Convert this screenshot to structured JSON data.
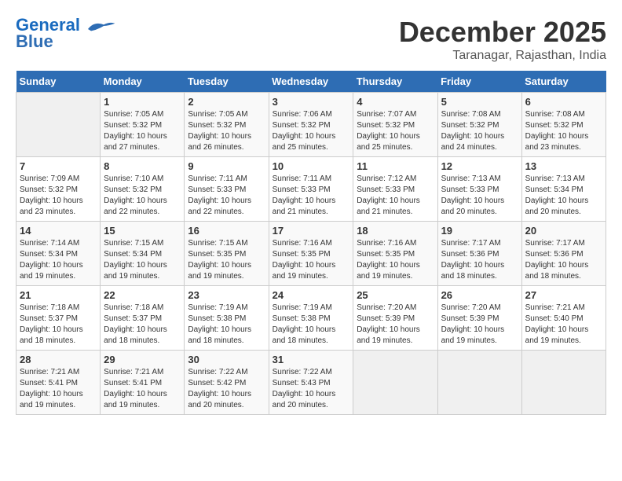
{
  "logo": {
    "line1": "General",
    "line2": "Blue"
  },
  "title": {
    "month": "December 2025",
    "location": "Taranagar, Rajasthan, India"
  },
  "weekdays": [
    "Sunday",
    "Monday",
    "Tuesday",
    "Wednesday",
    "Thursday",
    "Friday",
    "Saturday"
  ],
  "weeks": [
    [
      {
        "day": "",
        "info": ""
      },
      {
        "day": "1",
        "info": "Sunrise: 7:05 AM\nSunset: 5:32 PM\nDaylight: 10 hours\nand 27 minutes."
      },
      {
        "day": "2",
        "info": "Sunrise: 7:05 AM\nSunset: 5:32 PM\nDaylight: 10 hours\nand 26 minutes."
      },
      {
        "day": "3",
        "info": "Sunrise: 7:06 AM\nSunset: 5:32 PM\nDaylight: 10 hours\nand 25 minutes."
      },
      {
        "day": "4",
        "info": "Sunrise: 7:07 AM\nSunset: 5:32 PM\nDaylight: 10 hours\nand 25 minutes."
      },
      {
        "day": "5",
        "info": "Sunrise: 7:08 AM\nSunset: 5:32 PM\nDaylight: 10 hours\nand 24 minutes."
      },
      {
        "day": "6",
        "info": "Sunrise: 7:08 AM\nSunset: 5:32 PM\nDaylight: 10 hours\nand 23 minutes."
      }
    ],
    [
      {
        "day": "7",
        "info": "Sunrise: 7:09 AM\nSunset: 5:32 PM\nDaylight: 10 hours\nand 23 minutes."
      },
      {
        "day": "8",
        "info": "Sunrise: 7:10 AM\nSunset: 5:32 PM\nDaylight: 10 hours\nand 22 minutes."
      },
      {
        "day": "9",
        "info": "Sunrise: 7:11 AM\nSunset: 5:33 PM\nDaylight: 10 hours\nand 22 minutes."
      },
      {
        "day": "10",
        "info": "Sunrise: 7:11 AM\nSunset: 5:33 PM\nDaylight: 10 hours\nand 21 minutes."
      },
      {
        "day": "11",
        "info": "Sunrise: 7:12 AM\nSunset: 5:33 PM\nDaylight: 10 hours\nand 21 minutes."
      },
      {
        "day": "12",
        "info": "Sunrise: 7:13 AM\nSunset: 5:33 PM\nDaylight: 10 hours\nand 20 minutes."
      },
      {
        "day": "13",
        "info": "Sunrise: 7:13 AM\nSunset: 5:34 PM\nDaylight: 10 hours\nand 20 minutes."
      }
    ],
    [
      {
        "day": "14",
        "info": "Sunrise: 7:14 AM\nSunset: 5:34 PM\nDaylight: 10 hours\nand 19 minutes."
      },
      {
        "day": "15",
        "info": "Sunrise: 7:15 AM\nSunset: 5:34 PM\nDaylight: 10 hours\nand 19 minutes."
      },
      {
        "day": "16",
        "info": "Sunrise: 7:15 AM\nSunset: 5:35 PM\nDaylight: 10 hours\nand 19 minutes."
      },
      {
        "day": "17",
        "info": "Sunrise: 7:16 AM\nSunset: 5:35 PM\nDaylight: 10 hours\nand 19 minutes."
      },
      {
        "day": "18",
        "info": "Sunrise: 7:16 AM\nSunset: 5:35 PM\nDaylight: 10 hours\nand 19 minutes."
      },
      {
        "day": "19",
        "info": "Sunrise: 7:17 AM\nSunset: 5:36 PM\nDaylight: 10 hours\nand 18 minutes."
      },
      {
        "day": "20",
        "info": "Sunrise: 7:17 AM\nSunset: 5:36 PM\nDaylight: 10 hours\nand 18 minutes."
      }
    ],
    [
      {
        "day": "21",
        "info": "Sunrise: 7:18 AM\nSunset: 5:37 PM\nDaylight: 10 hours\nand 18 minutes."
      },
      {
        "day": "22",
        "info": "Sunrise: 7:18 AM\nSunset: 5:37 PM\nDaylight: 10 hours\nand 18 minutes."
      },
      {
        "day": "23",
        "info": "Sunrise: 7:19 AM\nSunset: 5:38 PM\nDaylight: 10 hours\nand 18 minutes."
      },
      {
        "day": "24",
        "info": "Sunrise: 7:19 AM\nSunset: 5:38 PM\nDaylight: 10 hours\nand 18 minutes."
      },
      {
        "day": "25",
        "info": "Sunrise: 7:20 AM\nSunset: 5:39 PM\nDaylight: 10 hours\nand 19 minutes."
      },
      {
        "day": "26",
        "info": "Sunrise: 7:20 AM\nSunset: 5:39 PM\nDaylight: 10 hours\nand 19 minutes."
      },
      {
        "day": "27",
        "info": "Sunrise: 7:21 AM\nSunset: 5:40 PM\nDaylight: 10 hours\nand 19 minutes."
      }
    ],
    [
      {
        "day": "28",
        "info": "Sunrise: 7:21 AM\nSunset: 5:41 PM\nDaylight: 10 hours\nand 19 minutes."
      },
      {
        "day": "29",
        "info": "Sunrise: 7:21 AM\nSunset: 5:41 PM\nDaylight: 10 hours\nand 19 minutes."
      },
      {
        "day": "30",
        "info": "Sunrise: 7:22 AM\nSunset: 5:42 PM\nDaylight: 10 hours\nand 20 minutes."
      },
      {
        "day": "31",
        "info": "Sunrise: 7:22 AM\nSunset: 5:43 PM\nDaylight: 10 hours\nand 20 minutes."
      },
      {
        "day": "",
        "info": ""
      },
      {
        "day": "",
        "info": ""
      },
      {
        "day": "",
        "info": ""
      }
    ]
  ]
}
